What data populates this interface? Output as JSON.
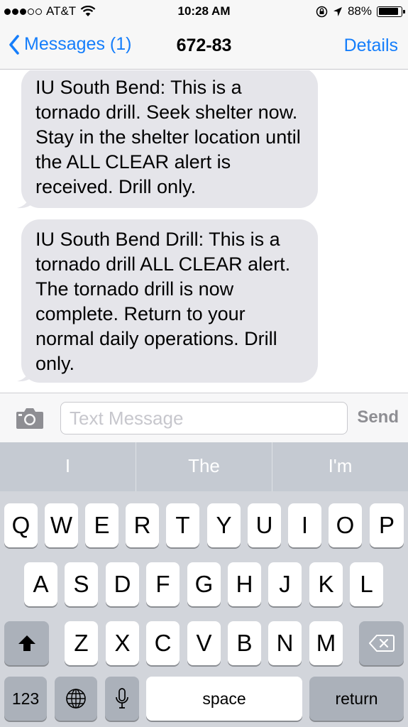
{
  "status_bar": {
    "carrier": "AT&T",
    "time": "10:28 AM",
    "battery_percent": "88%",
    "battery_level": 0.88,
    "signal_bars_filled": 3,
    "signal_bars_total": 5,
    "icons": [
      "wifi-icon",
      "orientation-lock-icon",
      "location-arrow-icon",
      "battery-icon"
    ]
  },
  "nav": {
    "back_label": "Messages (1)",
    "title": "672-83",
    "details_label": "Details"
  },
  "messages": [
    {
      "sender": "incoming",
      "text": "IU South Bend: This is a tornado drill. Seek shelter now. Stay in the shelter location until the ALL CLEAR alert is received. Drill only."
    },
    {
      "sender": "incoming",
      "text": "IU South Bend Drill: This is a tornado drill ALL CLEAR alert. The tornado drill is now complete. Return to your normal daily operations. Drill only."
    }
  ],
  "input": {
    "placeholder": "Text Message",
    "value": "",
    "send_label": "Send"
  },
  "keyboard": {
    "suggestions": [
      "I",
      "The",
      "I'm"
    ],
    "row1": [
      "Q",
      "W",
      "E",
      "R",
      "T",
      "Y",
      "U",
      "I",
      "O",
      "P"
    ],
    "row2": [
      "A",
      "S",
      "D",
      "F",
      "G",
      "H",
      "J",
      "K",
      "L"
    ],
    "row3": [
      "Z",
      "X",
      "C",
      "V",
      "B",
      "N",
      "M"
    ],
    "numbers_label": "123",
    "space_label": "space",
    "return_label": "return"
  },
  "colors": {
    "accent": "#157efb",
    "bubble_incoming": "#e5e5ea",
    "send_disabled": "#8e8e93",
    "keyboard_bg": "#d2d5db",
    "suggestion_bar": "#c5cad2",
    "dark_key": "#abb1ba"
  }
}
